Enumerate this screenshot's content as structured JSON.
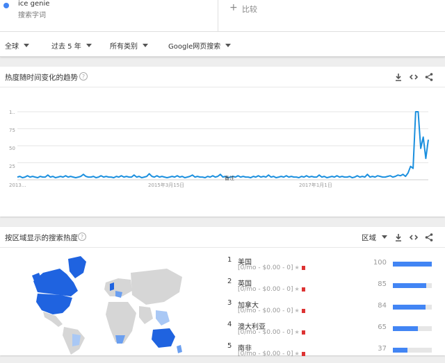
{
  "search_term": {
    "name": "ice genie",
    "type": "搜索字词",
    "dot_color": "#4285f4"
  },
  "compare": {
    "plus": "+",
    "label": "比较"
  },
  "filters": [
    "全球",
    "过去 5 年",
    "所有类别",
    "Google网页搜索"
  ],
  "interest_over_time": {
    "title": "热度随时间变化的趋势",
    "help": "?",
    "y_ticks": [
      "1..",
      "75",
      "50",
      "25"
    ],
    "x_ticks": [
      "2013...",
      "2015年3月15日",
      "2017年1月1日"
    ],
    "note_label": "备注"
  },
  "chart_data": {
    "type": "line",
    "ylim": [
      0,
      100
    ],
    "y_tick_values": [
      25,
      50,
      75,
      100
    ],
    "series": [
      {
        "color": "#1a8fde",
        "values": [
          2,
          3,
          1,
          2,
          4,
          2,
          3,
          2,
          1,
          3,
          2,
          2,
          5,
          2,
          3,
          1,
          2,
          3,
          2,
          4,
          2,
          3,
          2,
          1,
          2,
          3,
          6,
          3,
          2,
          2,
          3,
          1,
          2,
          4,
          2,
          3,
          2,
          2,
          1,
          3,
          2,
          4,
          2,
          3,
          2,
          2,
          5,
          2,
          3,
          1,
          2,
          3,
          7,
          3,
          2,
          4,
          2,
          3,
          2,
          1,
          2,
          3,
          2,
          4,
          2,
          3,
          1,
          2,
          3,
          5,
          2,
          3,
          2,
          2,
          1,
          3,
          2,
          4,
          2,
          3,
          6,
          2,
          3,
          1,
          2,
          3,
          2,
          4,
          2,
          3,
          2,
          2,
          1,
          3,
          2,
          4,
          2,
          3,
          2,
          5,
          2,
          3,
          1,
          2,
          3,
          2,
          4,
          2,
          3,
          2,
          2,
          1,
          3,
          2,
          4,
          2,
          3,
          2,
          2,
          5,
          2,
          3,
          1,
          2,
          3,
          2,
          4,
          2,
          3,
          2,
          2,
          3,
          1,
          2,
          4,
          2,
          3,
          2,
          6,
          2,
          3,
          2,
          4,
          3,
          2,
          2,
          3,
          4,
          2,
          3,
          5,
          4,
          6,
          3,
          8,
          18,
          15,
          100,
          100,
          45,
          62,
          30,
          58
        ]
      }
    ]
  },
  "interest_by_region": {
    "title": "按区域显示的搜索热度",
    "help": "?",
    "dropdown": "区域",
    "rows": [
      {
        "rank": "1",
        "name": "美国",
        "meta": "[0/mo - $0.00 - 0]",
        "value": 100
      },
      {
        "rank": "2",
        "name": "英国",
        "meta": "[0/mo - $0.00 - 0]",
        "value": 85
      },
      {
        "rank": "3",
        "name": "加拿大",
        "meta": "[0/mo - $0.00 - 0]",
        "value": 84
      },
      {
        "rank": "4",
        "name": "澳大利亚",
        "meta": "[0/mo - $0.00 - 0]",
        "value": 65
      },
      {
        "rank": "5",
        "name": "南非",
        "meta": "[0/mo - $0.00 - 0]",
        "value": 37
      }
    ]
  },
  "colors": {
    "accent": "#4285f4",
    "line": "#1a8fde",
    "map_high": "#1f63e0",
    "map_mid": "#6b9ff0",
    "map_low": "#a9c8f5",
    "map_none": "#d6d6d6"
  }
}
